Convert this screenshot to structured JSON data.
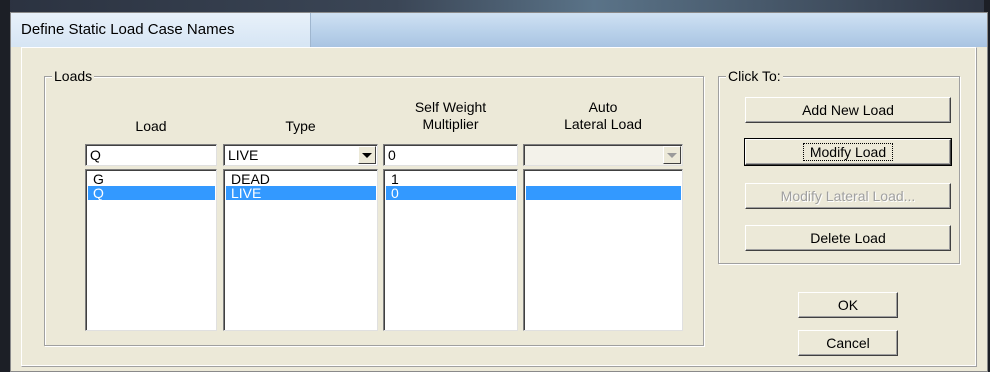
{
  "dialog": {
    "title": "Define Static Load Case Names"
  },
  "loads": {
    "group_label": "Loads",
    "headers": {
      "load": "Load",
      "type": "Type",
      "self_weight_line1": "Self Weight",
      "self_weight_line2": "Multiplier",
      "auto_lateral_line1": "Auto",
      "auto_lateral_line2": "Lateral Load"
    },
    "edit": {
      "load": "Q",
      "type": "LIVE",
      "self_weight": "0",
      "auto_lateral": ""
    },
    "rows": [
      {
        "load": "G",
        "type": "DEAD",
        "self_weight": "1",
        "auto_lateral": "",
        "selected": false
      },
      {
        "load": "Q",
        "type": "LIVE",
        "self_weight": "0",
        "auto_lateral": "",
        "selected": true
      }
    ]
  },
  "click_to": {
    "group_label": "Click To:",
    "add_new_load": "Add New Load",
    "modify_load": "Modify Load",
    "modify_lateral_load": "Modify Lateral Load...",
    "delete_load": "Delete Load"
  },
  "ok_label": "OK",
  "cancel_label": "Cancel",
  "colors": {
    "selection": "#3399ff",
    "dialog_face": "#ece9d8"
  }
}
